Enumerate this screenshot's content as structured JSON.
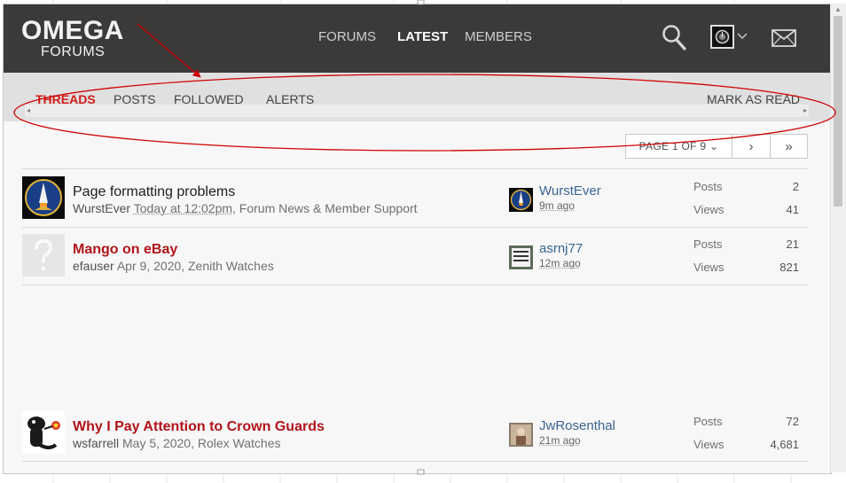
{
  "header": {
    "logo_top": "OMEGA",
    "logo_bottom": "FORUMS",
    "nav": [
      {
        "label": "FORUMS"
      },
      {
        "label": "LATEST"
      },
      {
        "label": "MEMBERS"
      }
    ]
  },
  "subnav": {
    "tabs": [
      {
        "label": "THREADS"
      },
      {
        "label": "POSTS"
      },
      {
        "label": "FOLLOWED"
      },
      {
        "label": "ALERTS"
      }
    ],
    "mark_read": "MARK AS READ"
  },
  "pager": {
    "page_label": "PAGE 1 OF 9 ⌄",
    "next": "›",
    "last": "»"
  },
  "threads": [
    {
      "title": "Page formatting problems",
      "author": "WurstEver",
      "date": "Today at 12:02pm",
      "forum": ", Forum News & Member Support",
      "last_user": "WurstEver",
      "last_time": "9m ago",
      "posts_label": "Posts",
      "posts": "2",
      "views_label": "Views",
      "views": "41"
    },
    {
      "title": "Mango on eBay",
      "author": "efauser",
      "date": "Apr 9, 2020",
      "forum": ", Zenith Watches",
      "last_user": "asrnj77",
      "last_time": "12m ago",
      "posts_label": "Posts",
      "posts": "21",
      "views_label": "Views",
      "views": "821"
    },
    {
      "title": "Why I Pay Attention to Crown Guards",
      "author": "wsfarrell",
      "date": "May 5, 2020",
      "forum": ", Rolex Watches",
      "last_user": "JwRosenthal",
      "last_time": "21m ago",
      "posts_label": "Posts",
      "posts": "72",
      "views_label": "Views",
      "views": "4,681"
    }
  ],
  "colors": {
    "header_bg": "#3b3a39",
    "subnav_bg": "#e0e0e0",
    "accent_red": "#d31b1b",
    "hot_title": "#b1131a",
    "link_blue": "#3a6592",
    "annotation": "#d00000"
  }
}
